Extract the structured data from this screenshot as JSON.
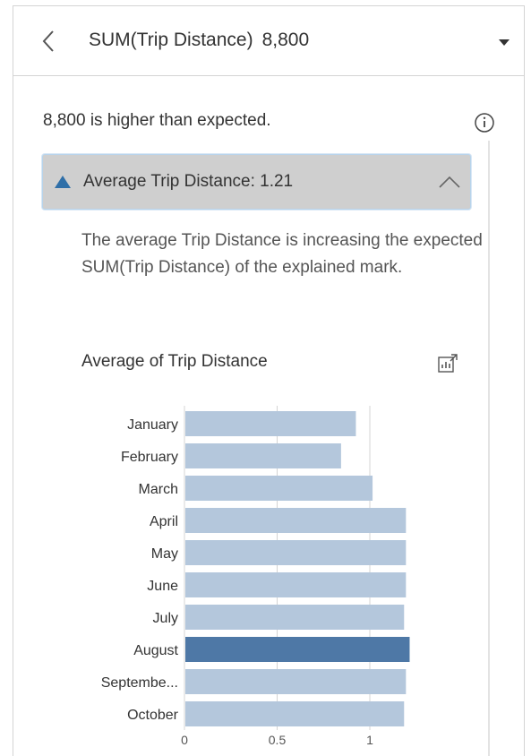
{
  "header": {
    "field": "SUM(Trip Distance)",
    "value": "8,800",
    "back_icon": "chevron-left-icon",
    "dropdown_icon": "caret-down-icon"
  },
  "summary": {
    "text": "8,800 is higher than expected.",
    "info_icon": "info-icon"
  },
  "section": {
    "label": "Average Trip Distance: 1.21",
    "indicator_icon": "triangle-up-icon",
    "collapse_icon": "chevron-up-icon",
    "description": "The average Trip Distance is increasing the expected SUM(Trip Distance) of the explained mark."
  },
  "chart_section": {
    "title": "Average of Trip Distance",
    "export_icon": "open-chart-icon"
  },
  "colors": {
    "bar": "#b4c7dc",
    "bar_highlight": "#4e78a6",
    "triangle": "#2f6fa8",
    "gridline": "#d4d4d4"
  },
  "chart_data": {
    "type": "bar",
    "orientation": "horizontal",
    "title": "Average of Trip Distance",
    "categories": [
      "January",
      "February",
      "March",
      "April",
      "May",
      "June",
      "July",
      "August",
      "Septembe...",
      "October"
    ],
    "values": [
      0.92,
      0.84,
      1.01,
      1.19,
      1.19,
      1.19,
      1.18,
      1.21,
      1.19,
      1.18
    ],
    "highlight": "August",
    "xlim": [
      0,
      1.25
    ],
    "xticks": [
      0,
      0.5,
      1
    ],
    "xtick_labels": [
      "0",
      "0.5",
      "1"
    ],
    "grid": true
  }
}
